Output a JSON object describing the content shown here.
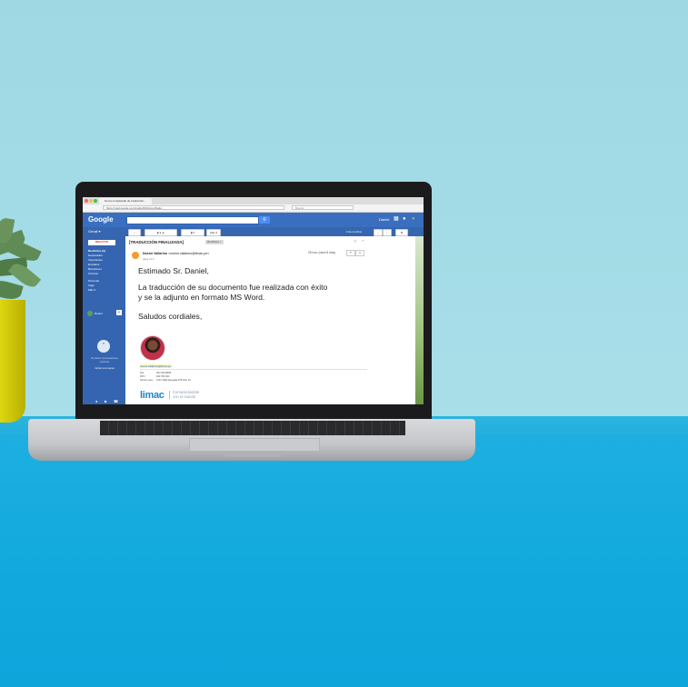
{
  "browser": {
    "tab_title": "Se ha completado de traducción...",
    "url": "https://mail.google.com/mail/u/0/#inbox/15a4c...",
    "search_placeholder": "Buscar"
  },
  "gmail": {
    "logo": "Google",
    "app_label": "Gmail ▾",
    "user_name": "Daniel",
    "compose_label": "REDACTAR",
    "nav_items": [
      "Recibidos (3)",
      "Destacados",
      "Importantes",
      "Enviados",
      "Borradores",
      "Círculos",
      "Personal",
      "Viaje",
      "Más ▾"
    ],
    "toolbar": {
      "more": "Más ▾",
      "pager": "2 de muchos"
    },
    "hangouts": {
      "user": "Daniel",
      "empty_note": "No tienes conversaciones recientes",
      "start_link": "Iniciar una nueva"
    }
  },
  "message": {
    "subject": "[TRADUCCIÓN FINALIZADA]",
    "label": "Recibidos ×",
    "sender_name": "Noemi Vallarino",
    "sender_email": "<noemi.vallarino@limac.pe>",
    "recipient": "para mí ▾",
    "date": "28 mar. (hace 8 días)",
    "greeting": "Estimado Sr. Daniel,",
    "body_line1": "La traducción de su documento fue realizada con éxito",
    "body_line2": "y se la adjunto en formato MS Word.",
    "closing": "Saludos cordiales,"
  },
  "signature": {
    "email": "noemi.vallarino@limac.pe",
    "rows": [
      {
        "label": "Fijo:",
        "value": "(01) 344-8635"
      },
      {
        "label": "RPC:",
        "value": "913 762 624"
      },
      {
        "label": "Santa Luisa:",
        "value": "Jirón Vidal Quesada 376 Piso 10"
      }
    ],
    "brand": "limac",
    "slogan_line1": "Comunicándote",
    "slogan_line2": "con el mundo"
  },
  "colors": {
    "wall": "#a3dbe6",
    "desk": "#12a8dd",
    "gmail_blue": "#3a6fbf",
    "limac_blue": "#1d84c9"
  }
}
